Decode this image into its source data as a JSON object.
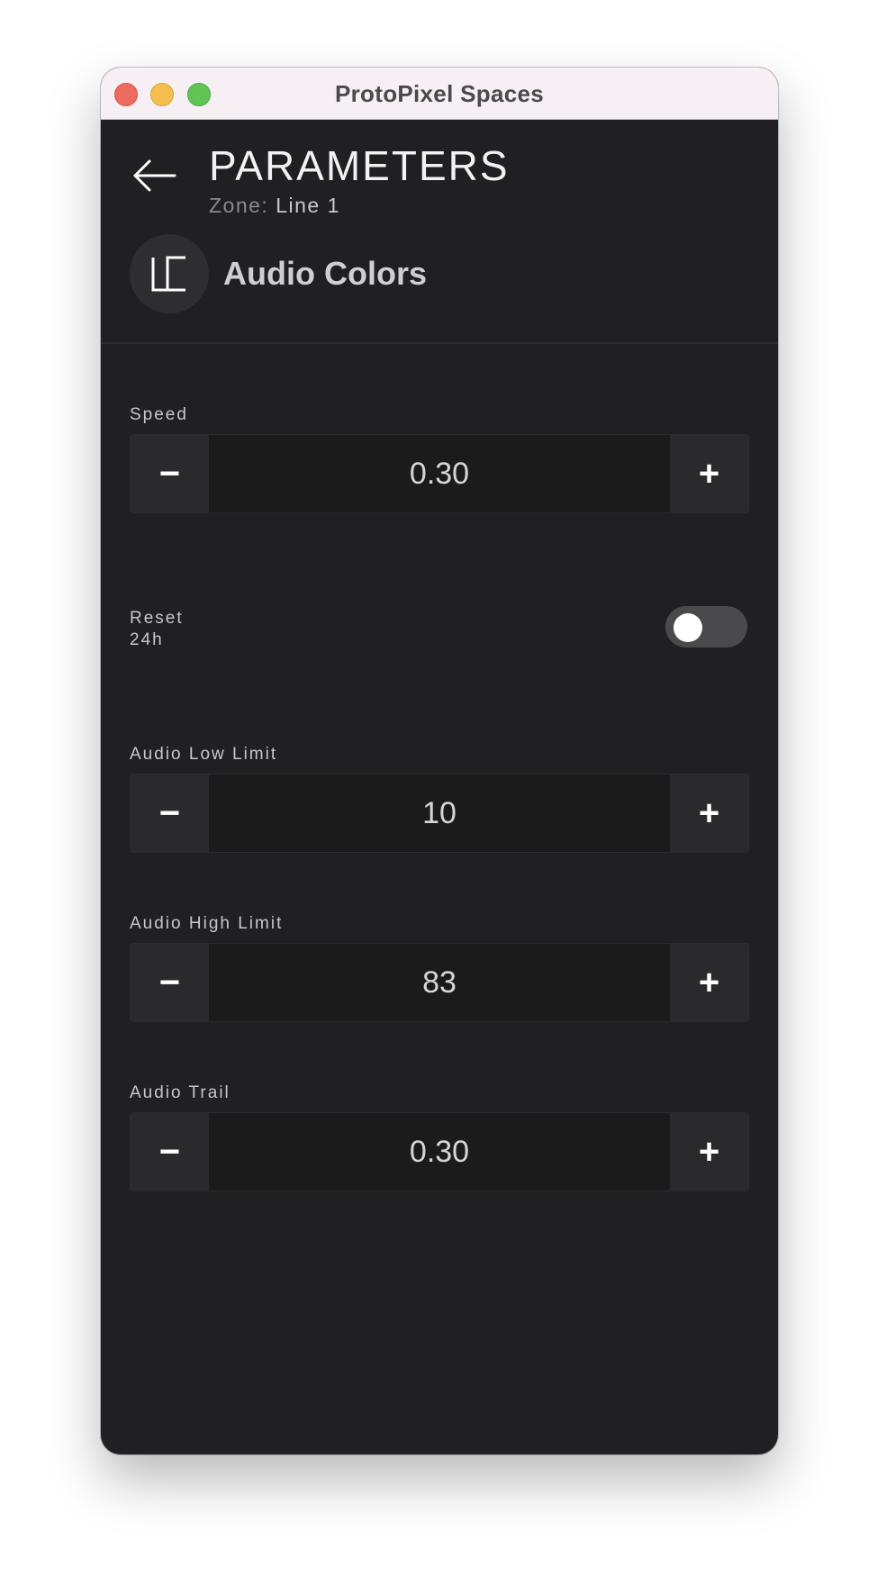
{
  "window": {
    "title": "ProtoPixel Spaces"
  },
  "header": {
    "page_title": "PARAMETERS",
    "zone_label": "Zone:",
    "zone_value": "Line 1",
    "pattern_name": "Audio Colors",
    "pattern_icon": "bracket-pattern-icon",
    "back_icon": "arrow-left-icon"
  },
  "params": {
    "speed": {
      "label": "Speed",
      "value": "0.30",
      "minus": "−",
      "plus": "+"
    },
    "reset": {
      "label_line1": "Reset",
      "label_line2": "24h",
      "on": false
    },
    "low_limit": {
      "label": "Audio Low Limit",
      "value": "10",
      "minus": "−",
      "plus": "+"
    },
    "high_limit": {
      "label": "Audio High Limit",
      "value": "83",
      "minus": "−",
      "plus": "+"
    },
    "trail": {
      "label": "Audio Trail",
      "value": "0.30",
      "minus": "−",
      "plus": "+"
    }
  },
  "colors": {
    "background": "#202022",
    "stepper_button": "#2a2a2c",
    "stepper_value_bg": "#1b1b1c",
    "toggle_off": "#4a4a4c",
    "titlebar": "#f6eff3",
    "close": "#ed6a5e",
    "minimize": "#f5bf4f",
    "maximize": "#61c554"
  }
}
